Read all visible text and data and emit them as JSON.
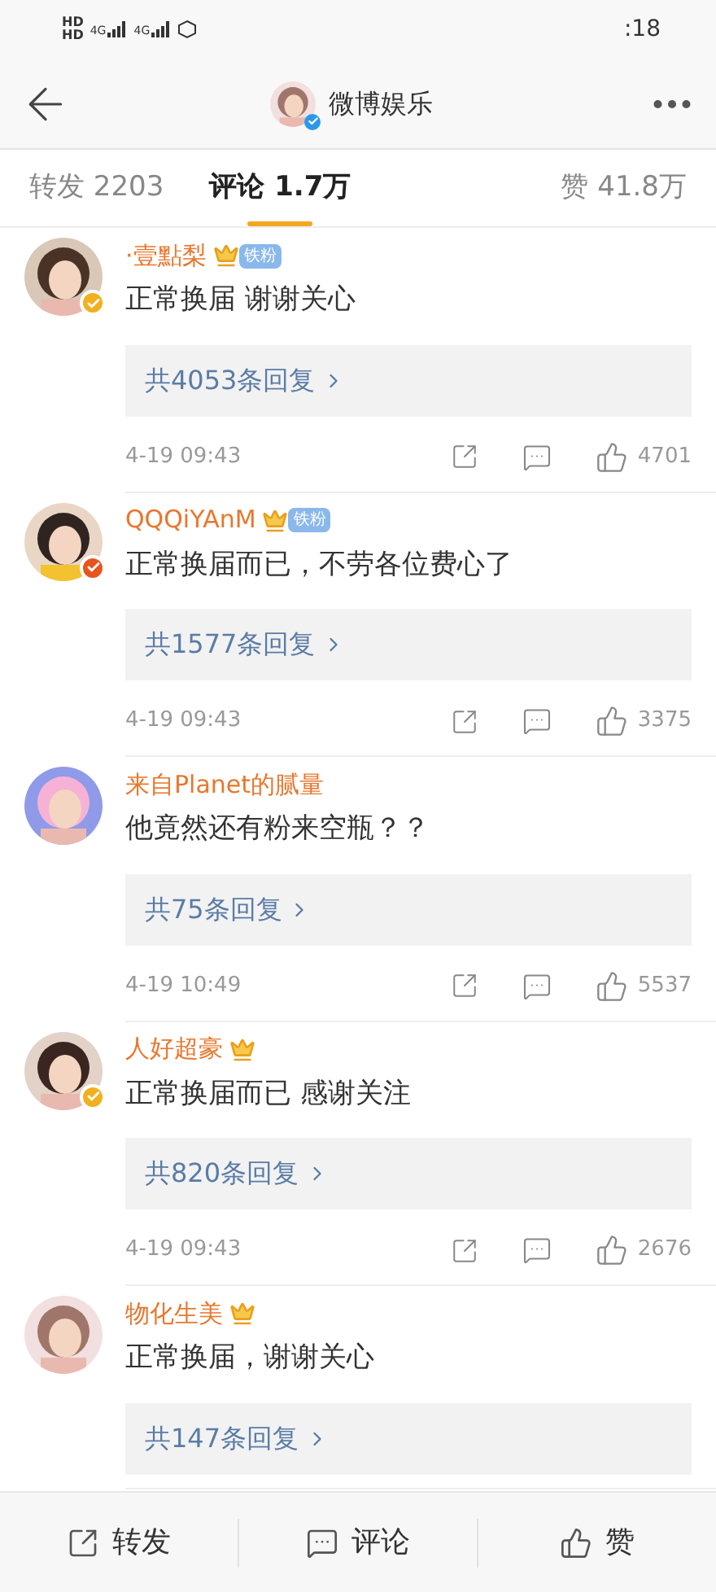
{
  "status_bar": {
    "sim_labels": [
      "HD",
      "HD"
    ],
    "networks": [
      "4G",
      "4G"
    ],
    "time": ":18"
  },
  "header": {
    "title": "微博娱乐"
  },
  "tabs": [
    {
      "label": "转发 2203",
      "selected": false
    },
    {
      "label": "评论 1.7万",
      "selected": true
    },
    {
      "label": "赞 41.8万",
      "selected": false
    }
  ],
  "comments": [
    {
      "name": "·壹點梨",
      "crown": true,
      "fan_badge": "铁粉",
      "verified": {
        "color": "#f2b01e"
      },
      "text": "正常换届 谢谢关心",
      "replies": "共4053条回复",
      "time": "4-19 09:43",
      "likes": "4701"
    },
    {
      "name": "QQQiYAnM",
      "crown": true,
      "fan_badge": "铁粉",
      "verified": {
        "color": "#e8541e"
      },
      "text": "正常换届而已，不劳各位费心了",
      "replies": "共1577条回复",
      "time": "4-19 09:43",
      "likes": "3375"
    },
    {
      "name": "来自Planet的腻量",
      "crown": false,
      "text": "他竟然还有粉来空瓶？？",
      "replies": "共75条回复",
      "time": "4-19 10:49",
      "likes": "5537"
    },
    {
      "name": "人好超豪",
      "crown": true,
      "verified": {
        "color": "#f2b01e"
      },
      "text": "正常换届而已 感谢关注",
      "replies": "共820条回复",
      "time": "4-19 09:43",
      "likes": "2676"
    },
    {
      "name": "物化生美",
      "crown": true,
      "text": "正常换届，谢谢关心",
      "replies": "共147条回复"
    }
  ],
  "bottom_bar": [
    {
      "kind": "repost",
      "label": "转发"
    },
    {
      "kind": "comment",
      "label": "评论"
    },
    {
      "kind": "like",
      "label": "赞"
    }
  ]
}
